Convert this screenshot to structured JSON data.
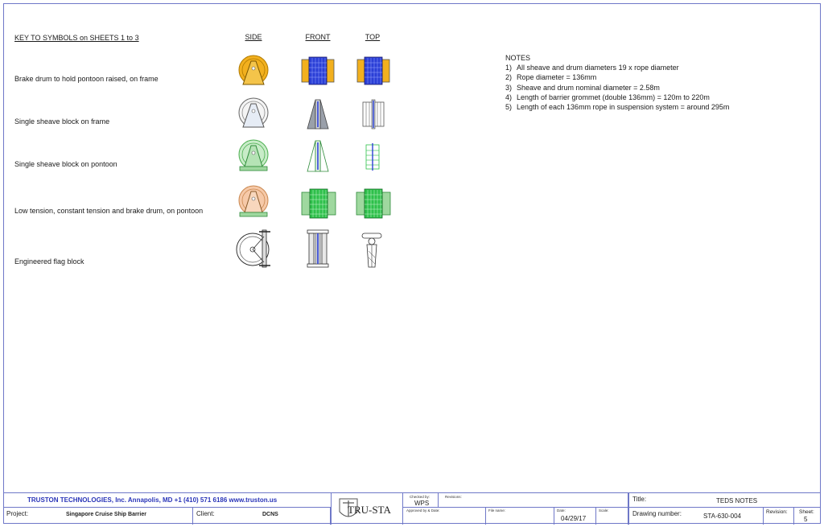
{
  "key": {
    "title": "KEY TO SYMBOLS on SHEETS 1 to 3",
    "views": [
      "SIDE",
      "FRONT",
      "TOP"
    ],
    "rows": [
      {
        "label": "Brake drum to hold pontoon raised, on frame"
      },
      {
        "label": "Single sheave block on frame"
      },
      {
        "label": "Single sheave block on pontoon"
      },
      {
        "label": "Low tension, constant tension and brake drum, on pontoon"
      },
      {
        "label": "Engineered flag block"
      }
    ]
  },
  "notes": {
    "title": "NOTES",
    "items": [
      {
        "num": "1)",
        "text": "All sheave and drum diameters 19 x rope diameter"
      },
      {
        "num": "2)",
        "text": "Rope diameter = 136mm"
      },
      {
        "num": "3)",
        "text": "Sheave and drum nominal diameter = 2.58m"
      },
      {
        "num": "4)",
        "text": "Length of barrier grommet (double 136mm) = 120m to 220m"
      },
      {
        "num": "5)",
        "text": "Length of each 136mm rope in suspension system = around 295m"
      }
    ]
  },
  "title_block": {
    "company": "TRUSTON TECHNOLOGIES, Inc.   Annapolis, MD   +1 (410) 571 6186   www.truston.us",
    "project_label": "Project:",
    "project": "Singapore Cruise Ship Barrier",
    "client_label": "Client:",
    "client": "DCNS",
    "logo_text": "TRU-STA",
    "checked_by_label": "Checked by:",
    "checked_by": "WPS",
    "revisions_label": "Revisions:",
    "approved_label": "Approved by & Date:",
    "file_name_label": "File name:",
    "date_label": "Date:",
    "date": "04/29/17",
    "scale_label": "Scale:",
    "title_label": "Title:",
    "title": "TEDS NOTES",
    "drawing_number_label": "Drawing number:",
    "drawing_number": "STA-630-004",
    "revision_label": "Revision:",
    "sheet_label": "Sheet:",
    "sheet": "5"
  },
  "colors": {
    "border": "#6f78c8",
    "brake_drum": "#f2b01e",
    "drum_blue": "#2b3fd6",
    "pontoon_green": "#9fd89f",
    "ltct_peach": "#f6c9a8",
    "ltct_green": "#2ec04a"
  }
}
